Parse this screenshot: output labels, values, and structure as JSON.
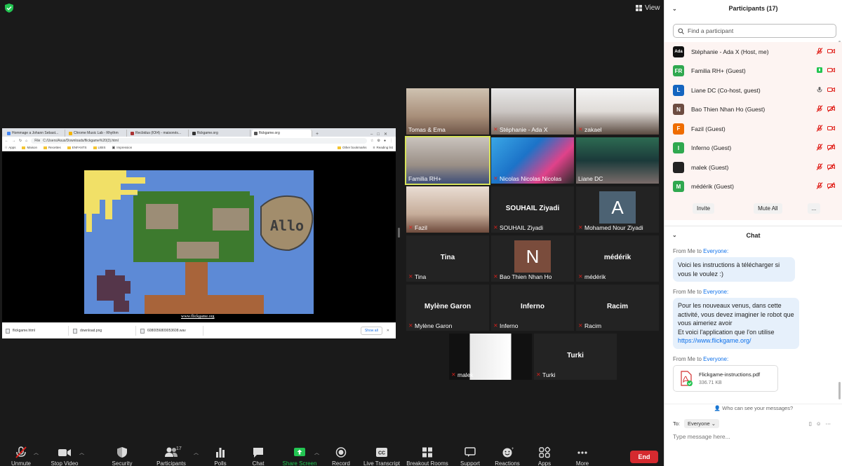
{
  "view_label": "View",
  "share": {
    "tabs": [
      "Hommage a Johann Sebast...",
      "Chrome Music Lab - Rhythm",
      "Recbidus (IOI4) - maisonés...",
      "flickgame.org",
      "flickgame.org"
    ],
    "address": "C:/Users/Asus/Downloads/flickgame%20(3).html",
    "address_prefix": "File",
    "bookmarks": [
      "Apps",
      "Maison",
      "Recettes",
      "ENFANTS",
      "LIBIS",
      "Impression"
    ],
    "bookmarks_right": [
      "Other bookmarks",
      "Reading list"
    ],
    "game_link": "www.flickgame.org",
    "game_sign": "Allo",
    "downloads": [
      "flickgame.html",
      "download.png",
      "6080056809053608.wav"
    ],
    "show_all": "Show all"
  },
  "tiles": [
    {
      "name": "Tomas & Ema",
      "big": "",
      "kind": "video",
      "muted": false
    },
    {
      "name": "Stéphanie - Ada X",
      "big": "",
      "kind": "video",
      "muted": true
    },
    {
      "name": "zakael",
      "big": "",
      "kind": "video",
      "muted": true
    },
    {
      "name": "Familia RH+",
      "big": "",
      "kind": "video",
      "muted": false
    },
    {
      "name": "Nicolas Nicolas Nicolas",
      "big": "",
      "kind": "video",
      "muted": true
    },
    {
      "name": "Liane DC",
      "big": "",
      "kind": "video",
      "muted": false
    },
    {
      "name": "Fazil",
      "big": "",
      "kind": "video",
      "muted": true
    },
    {
      "name": "SOUHAIL  Ziyadi",
      "big": "SOUHAIL  Ziyadi",
      "kind": "text",
      "muted": true
    },
    {
      "name": "Mohamed Nour Ziyadi",
      "big": "A",
      "kind": "avatarA",
      "muted": true
    },
    {
      "name": "Tina",
      "big": "Tina",
      "kind": "text",
      "muted": true
    },
    {
      "name": "Bao Thien Nhan Ho",
      "big": "N",
      "kind": "avatarN",
      "muted": true
    },
    {
      "name": "médérik",
      "big": "médérik",
      "kind": "text",
      "muted": true
    },
    {
      "name": "Mylène Garon",
      "big": "Mylène Garon",
      "kind": "text",
      "muted": true
    },
    {
      "name": "Inferno",
      "big": "Inferno",
      "kind": "text",
      "muted": true
    },
    {
      "name": "Racim",
      "big": "Racim",
      "kind": "text",
      "muted": true
    },
    {
      "name": "malek",
      "big": "",
      "kind": "video",
      "muted": true
    },
    {
      "name": "Turki",
      "big": "Turki",
      "kind": "text",
      "muted": true
    }
  ],
  "toolbar": {
    "unmute": "Unmute",
    "stop_video": "Stop Video",
    "security": "Security",
    "participants": "Participants",
    "participants_count": "17",
    "polls": "Polls",
    "chat": "Chat",
    "share_screen": "Share Screen",
    "record": "Record",
    "live_transcript": "Live Transcript",
    "breakout_rooms": "Breakout Rooms",
    "support": "Support",
    "reactions": "Reactions",
    "apps": "Apps",
    "more": "More",
    "end": "End",
    "cc_label": "CC"
  },
  "panel": {
    "participants_title": "Participants (17)",
    "search_placeholder": "Find a participant",
    "participants": [
      {
        "initials": "Ada",
        "color": "#111111",
        "name": "Stéphanie - Ada X (Host, me)",
        "mic": "muted",
        "video": "on"
      },
      {
        "initials": "FR",
        "color": "#2fa84f",
        "name": "Familia RH+ (Guest)",
        "mic": "active",
        "video": "on"
      },
      {
        "initials": "L",
        "color": "#1565c0",
        "name": "Liane DC (Co-host, guest)",
        "mic": "on",
        "video": "on"
      },
      {
        "initials": "N",
        "color": "#6d4c41",
        "name": "Bao Thien Nhan Ho (Guest)",
        "mic": "muted",
        "video": "off"
      },
      {
        "initials": "F",
        "color": "#ef6c00",
        "name": "Fazil (Guest)",
        "mic": "muted",
        "video": "on"
      },
      {
        "initials": "I",
        "color": "#2fa84f",
        "name": "Inferno (Guest)",
        "mic": "muted",
        "video": "off"
      },
      {
        "initials": "",
        "color": "#222222",
        "name": "malek (Guest)",
        "mic": "muted",
        "video": "off"
      },
      {
        "initials": "M",
        "color": "#2fa84f",
        "name": "médérik (Guest)",
        "mic": "muted",
        "video": "off"
      }
    ],
    "invite": "Invite",
    "mute_all": "Mute All",
    "more": "...",
    "chat_title": "Chat",
    "from_prefix": "From Me to",
    "everyone": "Everyone:",
    "msg1": "Voici les instructions à télécharger si vous le voulez :)",
    "msg2_lines": [
      "Pour les nouveaux venus, dans cette activité, vous devez imaginer le robot que vous aimeriez avoir",
      "Et voici l'application que l'on utilise"
    ],
    "msg2_link": "https://www.flickgame.org/",
    "file_name": "Flickgame-instructions.pdf",
    "file_size": "336.71 KB",
    "who_can_see": "Who can see your messages?",
    "to_label": "To:",
    "to_value": "Everyone",
    "type_placeholder": "Type message here..."
  }
}
